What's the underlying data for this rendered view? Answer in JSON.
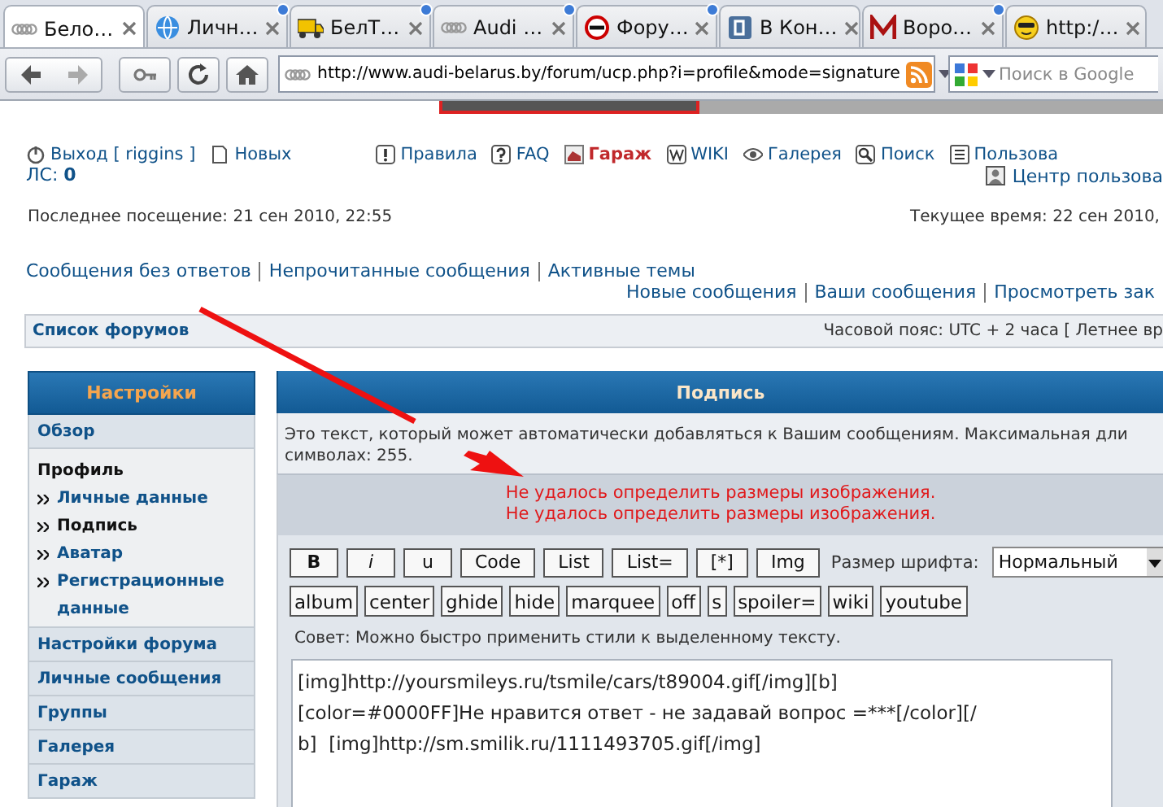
{
  "browser": {
    "tabs": [
      {
        "label": "Бело…",
        "selected": true,
        "updated": false
      },
      {
        "label": "Личн…",
        "selected": false,
        "updated": true
      },
      {
        "label": "БелТ…",
        "selected": false,
        "updated": true
      },
      {
        "label": "Audi …",
        "selected": false,
        "updated": true
      },
      {
        "label": "Фору…",
        "selected": false,
        "updated": true
      },
      {
        "label": "В Кон…",
        "selected": false,
        "updated": false
      },
      {
        "label": "Воро…",
        "selected": false,
        "updated": true
      },
      {
        "label": "http:/…",
        "selected": false,
        "updated": false
      }
    ],
    "address": "http://www.audi-belarus.by/forum/ucp.php?i=profile&mode=signature",
    "search": {
      "placeholder": "Поиск в Google"
    }
  },
  "header": {
    "nav": [
      {
        "label": "Выход [ riggins ]",
        "highlighted": false
      },
      {
        "label": "Новых",
        "highlighted": false
      },
      {
        "label": "Правила",
        "highlighted": false
      },
      {
        "label": "FAQ",
        "highlighted": false
      },
      {
        "label": "Гараж",
        "highlighted": true
      },
      {
        "label": "WIKI",
        "highlighted": false
      },
      {
        "label": "Галерея",
        "highlighted": false
      },
      {
        "label": "Поиск",
        "highlighted": false
      },
      {
        "label": "Пользова",
        "highlighted": false
      }
    ],
    "messages": "ЛС: **0**",
    "user_center": "Центр пользова",
    "last_visit": "Последнее посещение: 21 сен 2010, 22:55",
    "current_time": "Текущее время: 22 сен 2010,",
    "links_left": [
      "Сообщения без ответов",
      "Непрочитанные сообщения",
      "Активные темы"
    ],
    "links_right": [
      "Новые сообщения",
      "Ваши сообщения",
      "Просмотреть зак"
    ],
    "breadcrumb": "Список форумов",
    "timezone": "Часовой пояс: UTC + 2 часа [ Летнее вр"
  },
  "sidebar": {
    "title": "Настройки",
    "sections": [
      {
        "label": "Обзор"
      },
      {
        "label": "Профиль",
        "children": [
          {
            "label": "Личные данные",
            "selected": false
          },
          {
            "label": "Подпись",
            "selected": true
          },
          {
            "label": "Аватар",
            "selected": false
          },
          {
            "label": "Регистрационные данные",
            "selected": false
          }
        ]
      },
      {
        "label": "Настройки форума"
      },
      {
        "label": "Личные сообщения"
      },
      {
        "label": "Группы"
      },
      {
        "label": "Галерея"
      },
      {
        "label": "Гараж"
      }
    ]
  },
  "panel": {
    "title": "Подпись",
    "description": [
      "Это текст, который может автоматически добавляться к Вашим сообщениям. Максимальная дли",
      "символах: 255."
    ],
    "errors": [
      "Не удалось определить размеры изображения.",
      "Не удалось определить размеры изображения."
    ],
    "format_buttons": [
      {
        "label": "B",
        "kind": "bold"
      },
      {
        "label": "i",
        "kind": "italic"
      },
      {
        "label": "u",
        "kind": "plain"
      },
      {
        "label": "Code",
        "kind": "plain"
      },
      {
        "label": "List",
        "kind": "plain"
      },
      {
        "label": "List=",
        "kind": "plain"
      },
      {
        "label": "[*]",
        "kind": "plain"
      },
      {
        "label": "Img",
        "kind": "plain"
      }
    ],
    "font_size_label": "Размер шрифта:",
    "font_size_value": "Нормальный",
    "tag_buttons": [
      "album",
      "center",
      "ghide",
      "hide",
      "marquee",
      "off",
      "s",
      "spoiler=",
      "wiki",
      "youtube"
    ],
    "hint": "Совет: Можно быстро применить стили к выделенному тексту.",
    "signature_lines": [
      "[img]http://yoursmileys.ru/tsmile/cars/t89004.gif[/img][b]",
      "[color=#0000FF]Не нравится ответ - не задавай вопрос =***[/color][/",
      "b]  [img]http://sm.smilik.ru/1111493705.gif[/img]"
    ]
  }
}
